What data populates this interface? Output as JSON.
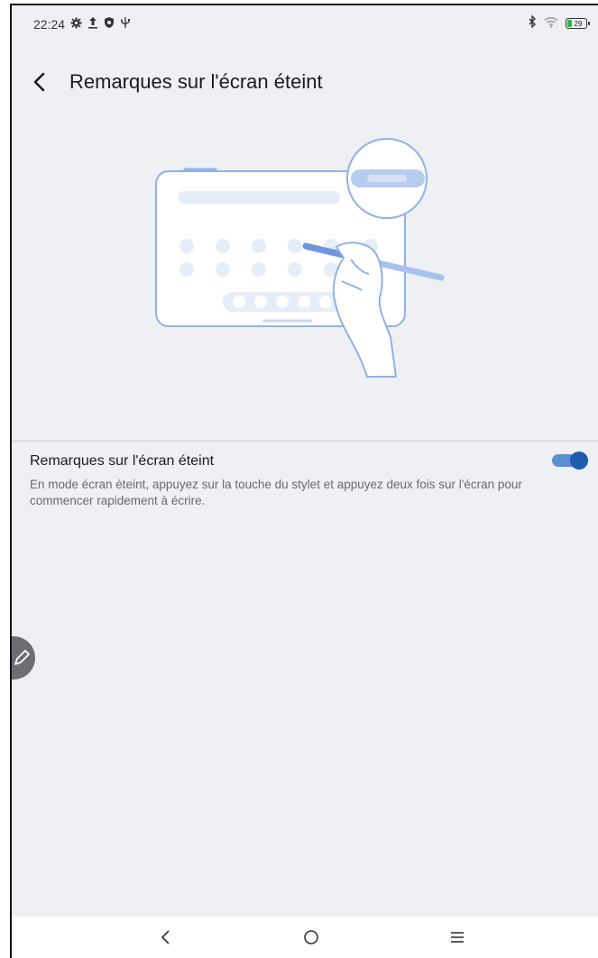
{
  "status_bar": {
    "time": "22:24",
    "icons_left": [
      "settings-gear-icon",
      "upload-icon",
      "shield-icon",
      "usb-icon"
    ],
    "icons_right": [
      "bluetooth-icon",
      "wifi-icon",
      "battery-icon"
    ],
    "battery_level": "29"
  },
  "header": {
    "title": "Remarques sur l'écran éteint",
    "back_icon": "chevron-left-icon"
  },
  "illustration": {
    "description_icon": "tablet-stylus-illustration"
  },
  "setting": {
    "title": "Remarques sur l'écran éteint",
    "description": "En mode écran éteint, appuyez sur la touche du stylet et appuyez deux fois sur l'écran pour commencer rapidement à écrire.",
    "enabled": true
  },
  "colors": {
    "background": "#eef0f4",
    "accent": "#1d5cae",
    "accent_track": "#5b8fd2",
    "illustration_stroke": "#8fb1e8"
  },
  "floating_button": {
    "icon": "pen-icon"
  },
  "nav_bar": {
    "back_icon": "nav-back-icon",
    "home_icon": "nav-home-icon",
    "menu_icon": "nav-menu-icon"
  }
}
